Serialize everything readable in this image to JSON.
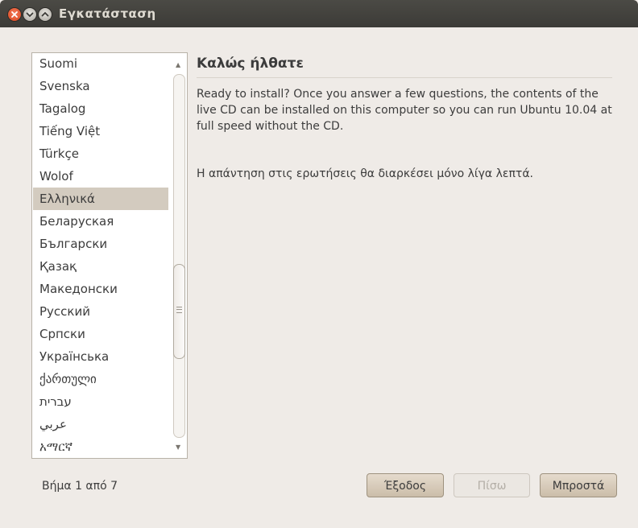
{
  "window": {
    "title": "Εγκατάσταση"
  },
  "languages": {
    "items": [
      "Suomi",
      "Svenska",
      "Tagalog",
      "Tiếng Việt",
      "Türkçe",
      "Wolof",
      "Ελληνικά",
      "Беларуская",
      "Български",
      "Қазақ",
      "Македонски",
      "Русский",
      "Српски",
      "Українська",
      "ქართული",
      "עברית",
      "عربي",
      "አማርኛ"
    ],
    "selected": "Ελληνικά",
    "scroll_position_fraction": 0.61
  },
  "main": {
    "heading": "Καλώς ήλθατε",
    "intro": "Ready to install?  Once you answer a few questions, the contents of the live CD can be installed on this computer so you can run Ubuntu 10.04 at full speed without the CD.",
    "note": "Η απάντηση στις ερωτήσεις θα διαρκέσει μόνο λίγα λεπτά."
  },
  "footer": {
    "step": "Βήμα 1 από 7",
    "buttons": {
      "exit": "Έξοδος",
      "back": "Πίσω",
      "forward": "Μπροστά"
    }
  },
  "colors": {
    "titlebar": "#3c3b37",
    "selection": "#d3cbbf",
    "button": "#d6cab9",
    "close": "#e25a2d"
  }
}
